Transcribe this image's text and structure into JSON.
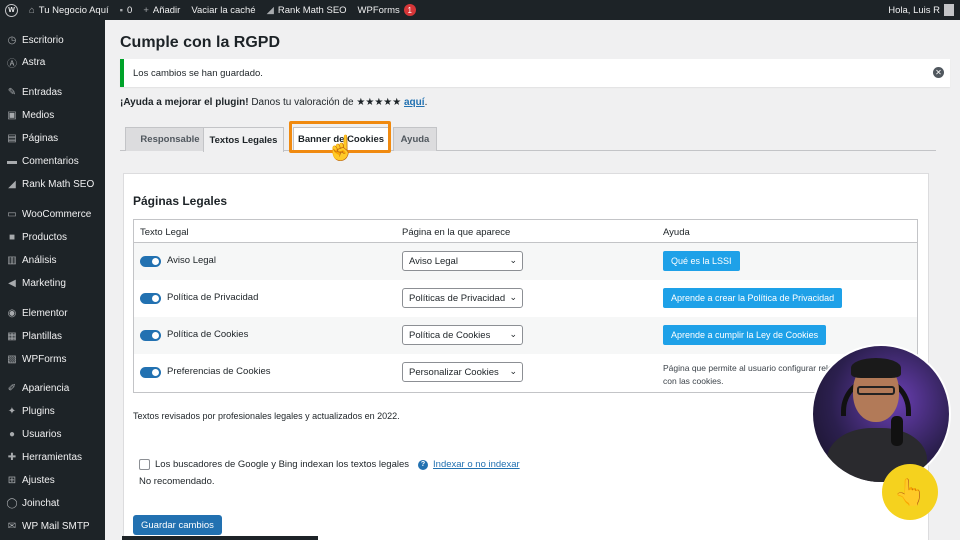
{
  "adminbar": {
    "site_name": "Tu Negocio Aquí",
    "comments_count": "0",
    "add_new": "Añadir",
    "clear_cache": "Vaciar la caché",
    "rank_math": "Rank Math SEO",
    "wpforms": "WPForms",
    "wpforms_badge": "1",
    "greeting": "Hola, Luis R"
  },
  "sidebar": {
    "items": [
      {
        "label": "Escritorio",
        "icon": "dashboard-icon"
      },
      {
        "label": "Astra",
        "icon": "astra-icon"
      },
      {
        "label": "Entradas",
        "icon": "pin-icon"
      },
      {
        "label": "Medios",
        "icon": "media-icon"
      },
      {
        "label": "Páginas",
        "icon": "pages-icon"
      },
      {
        "label": "Comentarios",
        "icon": "comments-icon"
      },
      {
        "label": "Rank Math SEO",
        "icon": "chart-icon"
      },
      {
        "label": "WooCommerce",
        "icon": "woo-icon"
      },
      {
        "label": "Productos",
        "icon": "box-icon"
      },
      {
        "label": "Análisis",
        "icon": "bar-chart-icon"
      },
      {
        "label": "Marketing",
        "icon": "megaphone-icon"
      },
      {
        "label": "Elementor",
        "icon": "elementor-icon"
      },
      {
        "label": "Plantillas",
        "icon": "folder-icon"
      },
      {
        "label": "WPForms",
        "icon": "form-icon"
      },
      {
        "label": "Apariencia",
        "icon": "brush-icon"
      },
      {
        "label": "Plugins",
        "icon": "plug-icon"
      },
      {
        "label": "Usuarios",
        "icon": "user-icon"
      },
      {
        "label": "Herramientas",
        "icon": "wrench-icon"
      },
      {
        "label": "Ajustes",
        "icon": "settings-icon"
      },
      {
        "label": "Joinchat",
        "icon": "chat-icon"
      },
      {
        "label": "WP Mail SMTP",
        "icon": "mail-icon"
      }
    ]
  },
  "page": {
    "title": "Cumple con la RGPD",
    "notice": "Los cambios se han guardado.",
    "rating_prefix": "¡Ayuda a mejorar el plugin!",
    "rating_text": " Danos tu valoración de ★★★★★ ",
    "rating_link": "aquí",
    "rating_suffix": "."
  },
  "tabs": [
    {
      "label": "Responsable"
    },
    {
      "label": "Textos Legales"
    },
    {
      "label": "Banner de Cookies"
    },
    {
      "label": "Ayuda"
    }
  ],
  "panel": {
    "heading": "Páginas Legales",
    "columns": [
      "Texto Legal",
      "Página en la que aparece",
      "Ayuda"
    ],
    "rows": [
      {
        "label": "Aviso Legal",
        "select": "Aviso Legal",
        "help_button": "Qué es la LSSI"
      },
      {
        "label": "Política de Privacidad",
        "select": "Políticas de Privacidad",
        "help_button": "Aprende a crear la Política de Privacidad"
      },
      {
        "label": "Política de Cookies",
        "select": "Política de Cookies",
        "help_button": "Aprende a cumplir la Ley de Cookies"
      },
      {
        "label": "Preferencias de Cookies",
        "select": "Personalizar Cookies",
        "help_text": "Página que permite al usuario configurar relación con las cookies."
      }
    ],
    "reviewed": "Textos revisados por profesionales legales y actualizados en 2022.",
    "index_label": "Los buscadores de Google y Bing indexan los textos legales",
    "index_link": "Indexar o no indexar",
    "not_recommended": "No recomendado.",
    "save": "Guardar cambios"
  },
  "colors": {
    "accent": "#2271b1",
    "help_button": "#1ea1e8",
    "highlight": "#f08a10",
    "success": "#00a32a"
  }
}
